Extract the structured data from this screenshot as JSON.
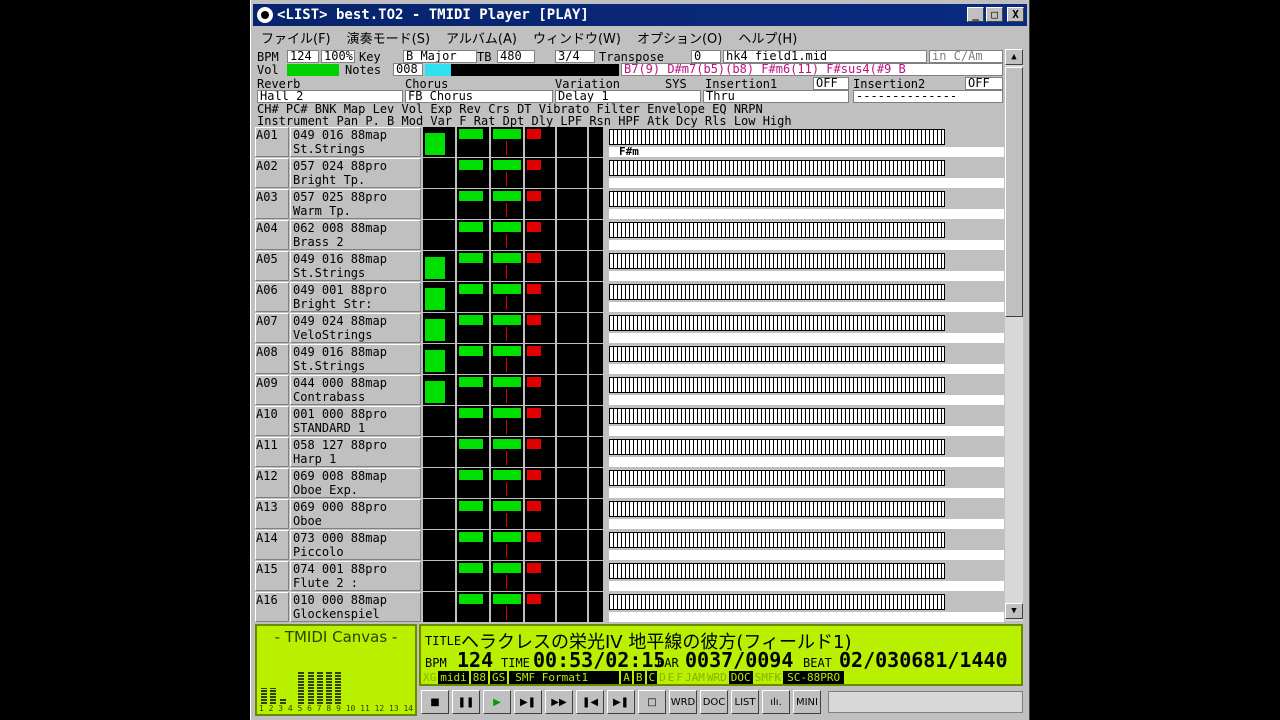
{
  "window": {
    "title": "<LIST> best.TO2 - TMIDI Player [PLAY]",
    "min": "_",
    "max": "□",
    "close": "X"
  },
  "menu": [
    "ファイル(F)",
    "演奏モード(S)",
    "アルバム(A)",
    "ウィンドウ(W)",
    "オプション(O)",
    "ヘルプ(H)"
  ],
  "info": {
    "bpm_label": "BPM",
    "bpm": "124",
    "tempo_pct": "100%",
    "key_label": "Key",
    "key": "B Major",
    "tb_label": "TB",
    "tb": "480",
    "meter": "3/4",
    "transpose_label": "Transpose",
    "transpose": "0",
    "file": "hk4_field1.mid",
    "in_key": "in C/Am",
    "vol_label": "Vol",
    "notes_label": "Notes",
    "notes": "008",
    "chords": "B7(9)  D#m7(b5)(b8)  F#m6(11)  F#sus4(#9 B",
    "reverb_label": "Reverb",
    "reverb": "Hall 2",
    "chorus_label": "Chorus",
    "chorus": "FB Chorus",
    "variation_label": "Variation",
    "variation": "Delay 1",
    "sys_label": "SYS",
    "ins1_label": "Insertion1",
    "ins1": "OFF",
    "ins1_val": "Thru",
    "ins2_label": "Insertion2",
    "ins2": "OFF",
    "ins2_val": "--------------",
    "hdr1": "CH# PC# BNK Map  Lev Vol Exp Rev Crs DT   Vibrato      Filter    Envelope  EQ   NRPN",
    "hdr2": "    Instrument       Pan P. B Mod Var F  Rat Dpt Dly LPF Rsn HPF Atk Dcy Rls Low  High"
  },
  "channels": [
    {
      "ch": "A01",
      "prog": "049 016 88map",
      "inst": "St.Strings",
      "lev": 0.9,
      "chord": "F#m"
    },
    {
      "ch": "A02",
      "prog": "057 024 88pro",
      "inst": "Bright Tp.",
      "lev": 0.0,
      "chord": ""
    },
    {
      "ch": "A03",
      "prog": "057 025 88pro",
      "inst": "Warm Tp.",
      "lev": 0.0,
      "chord": ""
    },
    {
      "ch": "A04",
      "prog": "062 008 88map",
      "inst": "Brass 2",
      "lev": 0.0,
      "chord": ""
    },
    {
      "ch": "A05",
      "prog": "049 016 88map",
      "inst": "St.Strings",
      "lev": 0.9,
      "chord": ""
    },
    {
      "ch": "A06",
      "prog": "049 001 88pro",
      "inst": "Bright Str:",
      "lev": 0.9,
      "chord": ""
    },
    {
      "ch": "A07",
      "prog": "049 024 88map",
      "inst": "VeloStrings",
      "lev": 0.9,
      "chord": ""
    },
    {
      "ch": "A08",
      "prog": "049 016 88map",
      "inst": "St.Strings",
      "lev": 0.9,
      "chord": ""
    },
    {
      "ch": "A09",
      "prog": "044 000 88map",
      "inst": "Contrabass",
      "lev": 0.9,
      "chord": ""
    },
    {
      "ch": "A10",
      "prog": "001 000 88pro",
      "inst": "STANDARD 1",
      "lev": 0.0,
      "chord": ""
    },
    {
      "ch": "A11",
      "prog": "058 127 88pro",
      "inst": "Harp 1",
      "lev": 0.0,
      "chord": ""
    },
    {
      "ch": "A12",
      "prog": "069 008 88map",
      "inst": "Oboe Exp.",
      "lev": 0.0,
      "chord": ""
    },
    {
      "ch": "A13",
      "prog": "069 000 88pro",
      "inst": "Oboe",
      "lev": 0.0,
      "chord": ""
    },
    {
      "ch": "A14",
      "prog": "073 000 88map",
      "inst": "Piccolo",
      "lev": 0.0,
      "chord": ""
    },
    {
      "ch": "A15",
      "prog": "074 001 88pro",
      "inst": "Flute 2   :",
      "lev": 0.0,
      "chord": ""
    },
    {
      "ch": "A16",
      "prog": "010 000 88map",
      "inst": "Glockenspiel",
      "lev": 0.0,
      "chord": ""
    }
  ],
  "canvas": {
    "title": "- TMIDI Canvas -",
    "labels": "1 2 3 4 5 6 7 8 9 10 11 12 13 14 15 16",
    "levels": [
      0.3,
      0.3,
      0.1,
      0.0,
      0.6,
      0.6,
      0.6,
      0.6,
      0.6,
      0.0,
      0.0,
      0.0,
      0.0,
      0.0,
      0.0,
      0.0
    ]
  },
  "status": {
    "title_label": "TITLE",
    "title": "ヘラクレスの栄光IV 地平線の彼方(フィールド1)",
    "bpm_label": "BPM",
    "bpm": "124",
    "time_label": "TIME",
    "time": "00:53/02:15",
    "bar_label": "BAR",
    "bar": "0037/0094",
    "beat_label": "BEAT",
    "beat": "02/030681/1440",
    "format": "SMF Format1",
    "module": "SC-88PRO",
    "tag_xg": "XG",
    "tag_midi": "midi",
    "tag_88": "88",
    "tag_gs": "GS",
    "ports": [
      "A",
      "B",
      "C",
      "D",
      "E",
      "F"
    ],
    "jam": "JAM",
    "wrd": "WRD",
    "doc": "DOC",
    "smfk": "SMFK"
  },
  "controls": [
    "■",
    "❚❚",
    "▶",
    "▶❚",
    "▶▶",
    "❚◀",
    "▶❚",
    "□",
    "WRD",
    "DOC",
    "LIST",
    "ılı.",
    "MINI"
  ]
}
